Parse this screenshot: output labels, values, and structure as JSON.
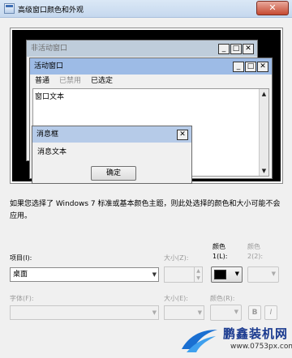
{
  "window": {
    "title": "高级窗口颜色和外观",
    "close_glyph": "✕"
  },
  "preview": {
    "inactive_title": "非活动窗口",
    "active_title": "活动窗口",
    "menu": {
      "normal": "普通",
      "disabled": "已禁用",
      "selected": "已选定"
    },
    "window_text": "窗口文本",
    "msgbox_title": "消息框",
    "msgbox_text": "消息文本",
    "ok_label": "确定",
    "cap_buttons": {
      "min": "_",
      "max": "□",
      "close": "✕"
    }
  },
  "description": "如果您选择了 Windows 7 标准或基本颜色主题，则此处选择的颜色和大小可能不会应用。",
  "form": {
    "item_label": "项目(I):",
    "item_value": "桌面",
    "size_label_1": "大小(Z):",
    "color1_label_top": "颜色",
    "color1_label_bottom": "1(L):",
    "color2_label_top": "颜色",
    "color2_label_bottom": "2(2):",
    "font_label": "字体(F):",
    "size_label_2": "大小(E):",
    "color_label": "颜色(R):",
    "bold_label": "B",
    "italic_label": "I"
  },
  "watermark": {
    "brand": "鹏鑫装机网",
    "url": "www.0753px.com"
  },
  "colors": {
    "color1": "#000000",
    "titlebar_active": "#9dbbe6",
    "preview_bg": "#000000"
  }
}
